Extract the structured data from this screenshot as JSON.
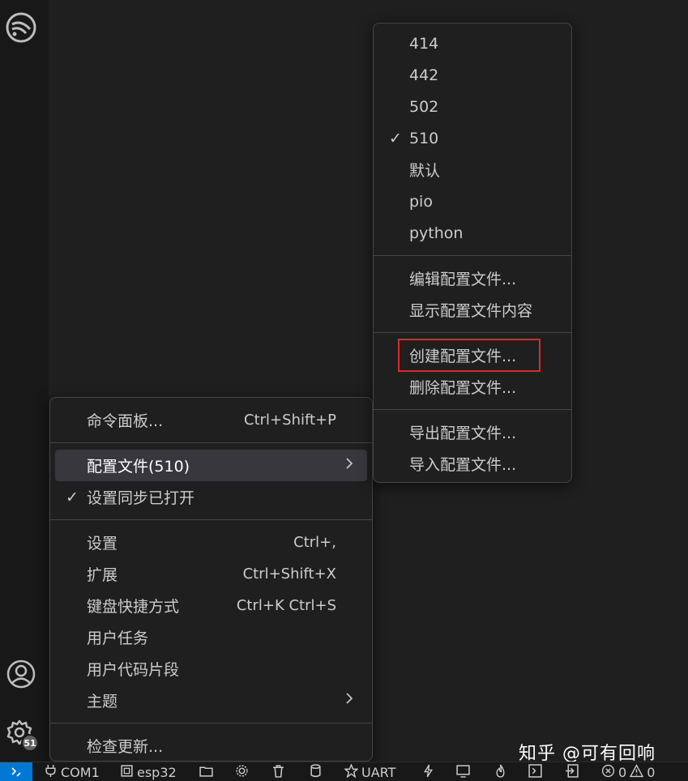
{
  "main_menu": {
    "items": [
      {
        "label": "命令面板...",
        "shortcut": "Ctrl+Shift+P"
      },
      {
        "label": "配置文件(510)",
        "submenu_arrow": "chevron-right-icon"
      },
      {
        "label": "设置同步已打开",
        "checked": "✓"
      },
      {
        "label": "设置",
        "shortcut": "Ctrl+,"
      },
      {
        "label": "扩展",
        "shortcut": "Ctrl+Shift+X"
      },
      {
        "label": "键盘快捷方式",
        "shortcut": "Ctrl+K Ctrl+S"
      },
      {
        "label": "用户任务"
      },
      {
        "label": "用户代码片段"
      },
      {
        "label": "主题",
        "submenu_arrow": "chevron-right-icon"
      },
      {
        "label": "检查更新..."
      }
    ]
  },
  "profiles_menu": {
    "profiles": [
      "414",
      "442",
      "502",
      "510",
      "默认",
      "pio",
      "python"
    ],
    "checked_mark": "✓",
    "actions": [
      "编辑配置文件...",
      "显示配置文件内容",
      "创建配置文件...",
      "删除配置文件...",
      "导出配置文件...",
      "导入配置文件..."
    ]
  },
  "activity_bar": {
    "manage_badge": "51"
  },
  "statusbar": {
    "remote_icon": "remote-icon",
    "port": "COM1",
    "target": "esp32",
    "flash_type": "UART",
    "errors": "0",
    "warnings": "0"
  },
  "watermark": "知乎 @可有回响",
  "colors": {
    "highlight": "#e0262c",
    "accent": "#0078d4",
    "background": "#1f1f1f"
  }
}
